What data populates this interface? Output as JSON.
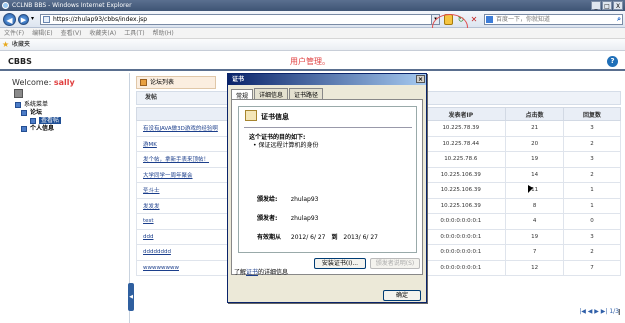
{
  "window": {
    "title": "CCLNB BBS - Windows Internet Explorer",
    "controls": [
      "_",
      "□",
      "X"
    ]
  },
  "addressbar": {
    "url": "https://zhulap93/cbbs/index.jsp",
    "search_placeholder": "百度一下，你就知道"
  },
  "menubar": {
    "items": [
      "文件(F)",
      "编辑(E)",
      "查看(V)",
      "收藏夹(A)",
      "工具(T)",
      "帮助(H)"
    ]
  },
  "favorites": {
    "label": "收藏夹"
  },
  "header": {
    "brand": "CBBS",
    "admin_text": "用户管理。"
  },
  "sidebar": {
    "welcome": "Welcome:",
    "user": "sally",
    "tree": [
      {
        "label": "系统菜单"
      },
      {
        "label": "论坛"
      },
      {
        "label": "查看帖"
      },
      {
        "label": "个人信息"
      }
    ]
  },
  "main": {
    "forum_tab": "论坛列表",
    "section": "发帖",
    "columns": [
      "标题",
      "发表者IP",
      "点击数",
      "回复数"
    ],
    "rows": [
      {
        "title": "有没有JAVA做3D游戏的经验啊",
        "ip": "10.225.78.39",
        "clicks": "21",
        "replies": "3"
      },
      {
        "title": "游MK",
        "ip": "10.225.78.44",
        "clicks": "20",
        "replies": "2"
      },
      {
        "title": "发个帖，拿新手表来顶帖！",
        "ip": "10.225.78.6",
        "clicks": "19",
        "replies": "3"
      },
      {
        "title": "大学同学一周年聚会",
        "ip": "10.225.106.39",
        "clicks": "14",
        "replies": "2"
      },
      {
        "title": "圣斗士",
        "ip": "10.225.106.39",
        "clicks": "11",
        "replies": "1"
      },
      {
        "title": "发发发",
        "ip": "10.225.106.39",
        "clicks": "8",
        "replies": "1"
      },
      {
        "title": "test",
        "ip": "0:0:0:0:0:0:0:1",
        "clicks": "4",
        "replies": "0"
      },
      {
        "title": "ddd",
        "ip": "0:0:0:0:0:0:0:1",
        "clicks": "19",
        "replies": "3"
      },
      {
        "title": "dddddddd",
        "ip": "0:0:0:0:0:0:0:1",
        "clicks": "7",
        "replies": "2"
      },
      {
        "title": "wwwwwwww",
        "ip": "0:0:0:0:0:0:0:1",
        "clicks": "12",
        "replies": "7"
      }
    ],
    "pager": "|◀ ◀ ▶ ▶| 1/3"
  },
  "dialog": {
    "title": "证书",
    "tabs": [
      "常规",
      "详细信息",
      "证书路径"
    ],
    "heading": "证书信息",
    "purpose_title": "这个证书的目的如下:",
    "purpose_item": "• 保证远程计算机的身份",
    "issued_to_label": "颁发给:",
    "issued_to": "zhulap93",
    "issued_by_label": "颁发者:",
    "issued_by": "zhulap93",
    "valid_label": "有效期从",
    "valid_from": "2012/ 6/ 27",
    "valid_to_label": "到",
    "valid_to": "2013/ 6/ 27",
    "install_button": "安装证书(I)...",
    "statement_button": "颁发者说明(S)",
    "learn_prefix": "了解",
    "learn_link": "证书",
    "learn_suffix": "的详细信息",
    "ok_button": "确定"
  }
}
